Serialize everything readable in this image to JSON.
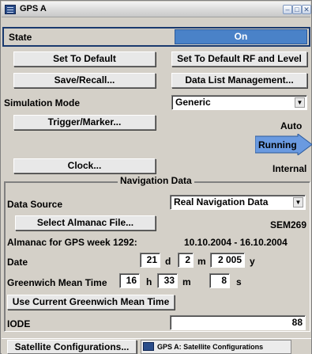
{
  "window": {
    "title": "GPS A"
  },
  "state": {
    "label": "State",
    "value": "On"
  },
  "buttons": {
    "set_default": "Set To Default",
    "set_default_rf": "Set To Default RF and Level",
    "save_recall": "Save/Recall...",
    "data_list": "Data List Management...",
    "trigger_marker": "Trigger/Marker...",
    "clock": "Clock..."
  },
  "simulation": {
    "label": "Simulation Mode",
    "value": "Generic"
  },
  "trigger": {
    "mode": "Auto",
    "status": "Running"
  },
  "clock": {
    "source": "Internal"
  },
  "navigation": {
    "title": "Navigation Data",
    "data_source_label": "Data Source",
    "data_source_value": "Real Navigation Data",
    "select_almanac_button": "Select Almanac File...",
    "almanac_file": "SEM269",
    "almanac_week_label": "Almanac for GPS week 1292:",
    "almanac_range": "10.10.2004 - 16.10.2004",
    "date_label": "Date",
    "date_day": "21",
    "date_day_unit": "d",
    "date_month": "2",
    "date_month_unit": "m",
    "date_year": "2 005",
    "date_year_unit": "y",
    "gmt_label": "Greenwich Mean Time",
    "gmt_hour": "16",
    "gmt_hour_unit": "h",
    "gmt_min": "33",
    "gmt_min_unit": "m",
    "gmt_sec": "8",
    "gmt_sec_unit": "s",
    "use_current_gmt_button": "Use Current Greenwich Mean Time",
    "iode_label": "IODE",
    "iode_value": "88"
  },
  "bottom": {
    "satellite_button": "Satellite Configurations...",
    "task_label": "GPS A: Satellite Configurations"
  },
  "colors": {
    "state_on_bg": "#4a82c8",
    "running_arrow": "#6a9ae0",
    "border_dark": "#1a3a6e"
  }
}
